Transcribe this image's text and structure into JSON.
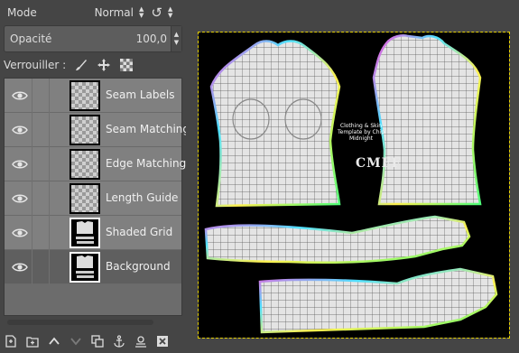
{
  "toolbar": {
    "mode_label": "Mode",
    "mode_value": "Normal",
    "opacity_label": "Opacité",
    "opacity_value": "100,0",
    "lock_label": "Verrouiller :",
    "lock_icons": [
      "paintbrush-icon",
      "move-cross-icon",
      "checkerboard-alpha-icon"
    ]
  },
  "layers": [
    {
      "name": "Seam Labels",
      "visible": true,
      "selected": false
    },
    {
      "name": "Seam Matching",
      "visible": true,
      "selected": false
    },
    {
      "name": "Edge Matching",
      "visible": true,
      "selected": false
    },
    {
      "name": "Length Guide",
      "visible": true,
      "selected": false
    },
    {
      "name": "Shaded Grid",
      "visible": true,
      "selected": false
    },
    {
      "name": "Background",
      "visible": true,
      "selected": true
    }
  ],
  "bottom_tools": [
    "new-layer-icon",
    "new-group-icon",
    "raise-layer-icon",
    "lower-layer-icon",
    "duplicate-layer-icon",
    "anchor-icon",
    "mask-icon",
    "delete-layer-icon"
  ],
  "canvas": {
    "template_caption": "Clothing & Skin Template by Chip Midnight",
    "logo_text": "CMFF"
  },
  "colors": {
    "panel_bg": "#454545",
    "layer_bg": "#808080",
    "selected_layer_bg": "#5f5f5f",
    "canvas_bg": "#000000",
    "selection_outline": "#e5d000"
  }
}
